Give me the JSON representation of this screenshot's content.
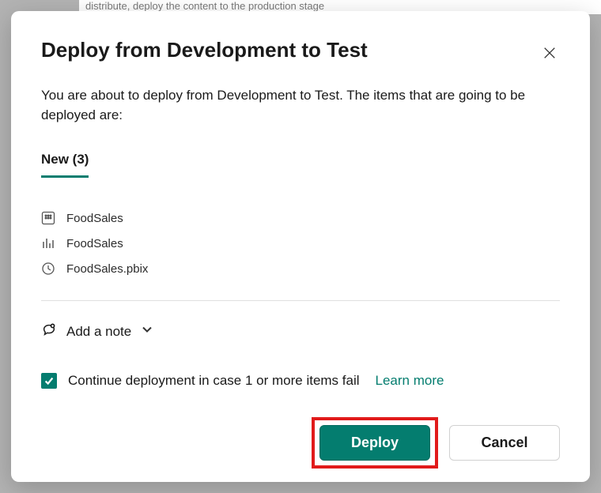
{
  "background_hint": "distribute, deploy the content to the production stage",
  "dialog": {
    "title": "Deploy from Development to Test",
    "description": "You are about to deploy from Development to Test. The items that are going to be deployed are:",
    "tab": {
      "label": "New (3)"
    },
    "items": [
      {
        "icon": "dataset-icon",
        "label": "FoodSales"
      },
      {
        "icon": "report-icon",
        "label": "FoodSales"
      },
      {
        "icon": "file-icon",
        "label": "FoodSales.pbix"
      }
    ],
    "add_note_label": "Add a note",
    "checkbox": {
      "checked": true,
      "label": "Continue deployment in case 1 or more items fail",
      "learn_more": "Learn more"
    },
    "buttons": {
      "deploy": "Deploy",
      "cancel": "Cancel"
    }
  }
}
